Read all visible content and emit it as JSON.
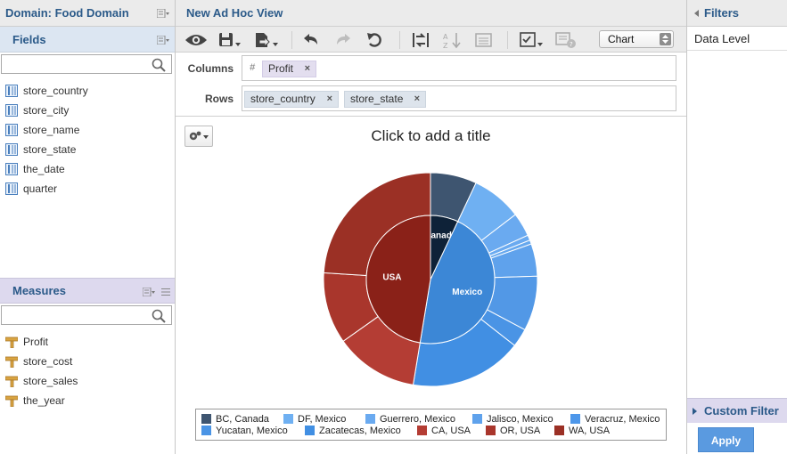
{
  "left": {
    "domain_title": "Domain: Food Domain",
    "fields_title": "Fields",
    "fields_search_placeholder": "",
    "fields": [
      "store_country",
      "store_city",
      "store_name",
      "store_state",
      "the_date",
      "quarter"
    ],
    "measures_title": "Measures",
    "measures_search_placeholder": "",
    "measures": [
      "Profit",
      "store_cost",
      "store_sales",
      "the_year"
    ]
  },
  "center": {
    "view_title": "New Ad Hoc View",
    "chart_type_select": "Chart",
    "columns_label": "Columns",
    "columns_hash": "#",
    "columns": [
      "Profit"
    ],
    "rows_label": "Rows",
    "rows": [
      "store_country",
      "store_state"
    ],
    "chart_title_placeholder": "Click to add a title"
  },
  "right": {
    "filters_title": "Filters",
    "data_level": "Data Level",
    "custom_filter": "Custom Filter",
    "apply": "Apply"
  },
  "chart_data": {
    "type": "pie",
    "variant": "sunburst",
    "inner_ring": [
      {
        "label": "Canada",
        "value": 7.0,
        "color": "#0e2238"
      },
      {
        "label": "Mexico",
        "value": 45.6,
        "color": "#3c87d6"
      },
      {
        "label": "USA",
        "value": 47.4,
        "color": "#8a2118"
      }
    ],
    "outer_ring": [
      {
        "label": "BC, Canada",
        "parent": "Canada",
        "value": 7.0,
        "color": "#3e5570"
      },
      {
        "label": "DF, Mexico",
        "parent": "Mexico",
        "value": 7.6,
        "color": "#6fb0f2"
      },
      {
        "label": "Guerrero, Mexico",
        "parent": "Mexico",
        "value": 3.6,
        "color": "#6aaaf0"
      },
      {
        "label": "",
        "parent": "Mexico",
        "value": 0.8,
        "color": "#6aaaf0"
      },
      {
        "label": "Jalisco, Mexico",
        "parent": "Mexico",
        "value": 0.6,
        "color": "#66a8ee"
      },
      {
        "label": "",
        "parent": "Mexico",
        "value": 4.9,
        "color": "#5fa2ec"
      },
      {
        "label": "Veracruz, Mexico",
        "parent": "Mexico",
        "value": 8.3,
        "color": "#5298e6"
      },
      {
        "label": "Yucatan, Mexico",
        "parent": "Mexico",
        "value": 2.8,
        "color": "#4a94e5"
      },
      {
        "label": "Zacatecas, Mexico",
        "parent": "Mexico",
        "value": 17.0,
        "color": "#418fe3"
      },
      {
        "label": "CA, USA",
        "parent": "USA",
        "value": 12.6,
        "color": "#b43d34"
      },
      {
        "label": "OR, USA",
        "parent": "USA",
        "value": 10.8,
        "color": "#a9362c"
      },
      {
        "label": "WA, USA",
        "parent": "USA",
        "value": 24.0,
        "color": "#9b3025"
      }
    ],
    "legend": [
      {
        "label": "BC, Canada",
        "color": "#3e5570"
      },
      {
        "label": "DF, Mexico",
        "color": "#6fb0f2"
      },
      {
        "label": "Guerrero, Mexico",
        "color": "#6aaaf0"
      },
      {
        "label": "Jalisco, Mexico",
        "color": "#5fa2ec"
      },
      {
        "label": "Veracruz, Mexico",
        "color": "#4d97ea"
      },
      {
        "label": "Yucatan, Mexico",
        "color": "#4a94e5"
      },
      {
        "label": "Zacatecas, Mexico",
        "color": "#418fe3"
      },
      {
        "label": "CA, USA",
        "color": "#b43d34"
      },
      {
        "label": "OR, USA",
        "color": "#a9362c"
      },
      {
        "label": "WA, USA",
        "color": "#9b3025"
      }
    ],
    "legend_position": "bottom"
  }
}
